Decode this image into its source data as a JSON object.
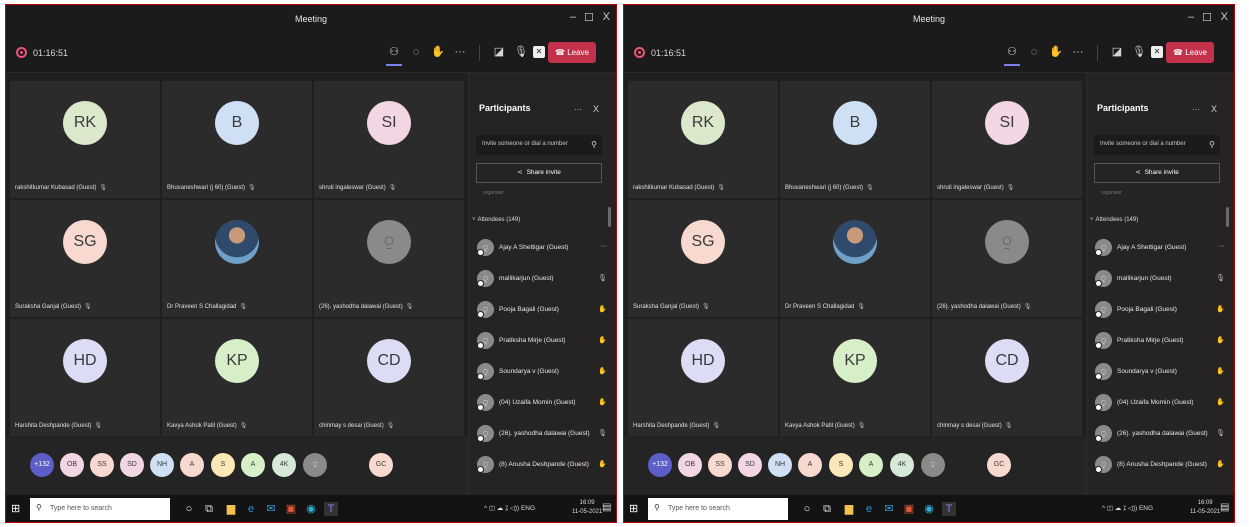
{
  "window": {
    "title": "Meeting",
    "min": "–",
    "max": "☐",
    "close": "X"
  },
  "call": {
    "timer": "01:16:51",
    "leave_label": "Leave",
    "more": "···"
  },
  "tiles": [
    {
      "initials": "RK",
      "bg": "#dce8cc",
      "name": "rakshitkumar Kubasad (Guest)"
    },
    {
      "initials": "B",
      "bg": "#cfe0f5",
      "name": "Bhuvaneshwari (j 60) (Guest)"
    },
    {
      "initials": "SI",
      "bg": "#f3d6e4",
      "name": "shruti ingaleswar (Guest)"
    },
    {
      "initials": "SG",
      "bg": "#f8d9cf",
      "name": "Suraksha Ganjal (Guest)"
    },
    {
      "initials": "",
      "bg": "#2f4a6a",
      "name": "Dr Praveen S Challagidad"
    },
    {
      "initials": "⍜",
      "bg": "#8a8a8a",
      "name": "(26). yashodha dalawai (Guest)"
    },
    {
      "initials": "HD",
      "bg": "#dcdcf5",
      "name": "Harshita Deshpande (Guest)"
    },
    {
      "initials": "KP",
      "bg": "#d6efc9",
      "name": "Kavya Ashok Patil (Guest)"
    },
    {
      "initials": "CD",
      "bg": "#dcdcf5",
      "name": "chinmay s desai (Guest)"
    }
  ],
  "bubbles": [
    {
      "label": "+132",
      "bg": "#5b5fc7",
      "fg": "#ffffff"
    },
    {
      "label": "OB",
      "bg": "#f3d6e4",
      "fg": "#3b3b3b"
    },
    {
      "label": "SS",
      "bg": "#f8d9cf",
      "fg": "#3b3b3b"
    },
    {
      "label": "SD",
      "bg": "#f3d6e4",
      "fg": "#3b3b3b"
    },
    {
      "label": "NH",
      "bg": "#cfe0f5",
      "fg": "#3b3b3b"
    },
    {
      "label": "A",
      "bg": "#f8d9cf",
      "fg": "#3b3b3b"
    },
    {
      "label": "S",
      "bg": "#fbe8b8",
      "fg": "#3b3b3b"
    },
    {
      "label": "A",
      "bg": "#d6efc9",
      "fg": "#3b3b3b"
    },
    {
      "label": "4K",
      "bg": "#d6e8d6",
      "fg": "#3b3b3b"
    },
    {
      "label": "⍜",
      "bg": "#8a8a8a",
      "fg": "#e6e6e6"
    },
    {
      "label": "GC",
      "bg": "#f8d9cf",
      "fg": "#3b3b3b"
    }
  ],
  "panel": {
    "title": "Participants",
    "more": "···",
    "close": "X",
    "invite_placeholder": "Invite someone or dial a number",
    "share_label": "Share invite",
    "cut_text": "organiser",
    "attendees_label": "Attendees (149)",
    "attendees": [
      {
        "name": "Ajay A Shettigar (Guest)",
        "action": "···",
        "kind": "more"
      },
      {
        "name": "mallikarjun (Guest)",
        "action": "🎙",
        "kind": "muted"
      },
      {
        "name": "Pooja Bagali (Guest)",
        "action": "✋",
        "kind": ""
      },
      {
        "name": "Pratiksha Mirje (Guest)",
        "action": "✋",
        "kind": ""
      },
      {
        "name": "Soundarya v (Guest)",
        "action": "✋",
        "kind": ""
      },
      {
        "name": "(04) Uzaifa Momin (Guest)",
        "action": "✋",
        "kind": ""
      },
      {
        "name": "(26). yashodha dalawai (Guest)",
        "action": "🎙",
        "kind": "muted"
      },
      {
        "name": "(8) Anusha Deshpande (Guest)",
        "action": "✋",
        "kind": ""
      }
    ]
  },
  "taskbar": {
    "search_placeholder": "Type here to search",
    "tray": "^ ◫ ☁ ⁒ ◁)) ENG",
    "time": "16:09",
    "date": "11-05-2021"
  },
  "colors": {
    "accent": "#7b83eb",
    "leave": "#c4314b",
    "border": "#c00000"
  }
}
